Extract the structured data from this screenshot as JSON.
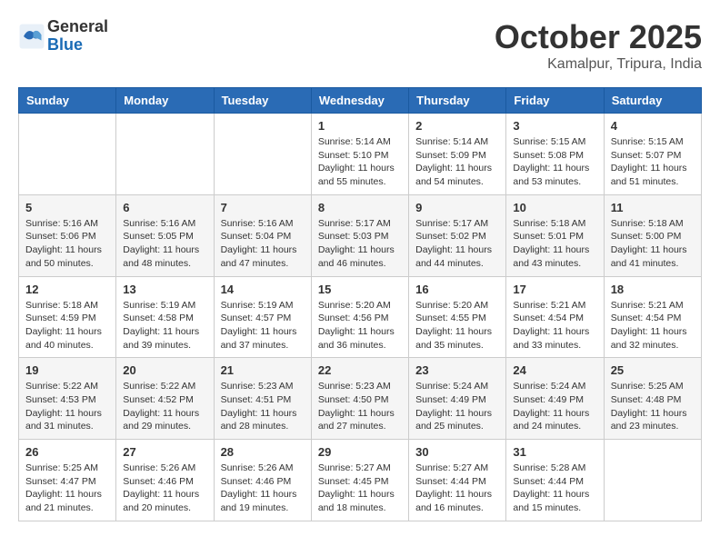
{
  "logo": {
    "general": "General",
    "blue": "Blue"
  },
  "title": {
    "month": "October 2025",
    "location": "Kamalpur, Tripura, India"
  },
  "weekdays": [
    "Sunday",
    "Monday",
    "Tuesday",
    "Wednesday",
    "Thursday",
    "Friday",
    "Saturday"
  ],
  "weeks": [
    [
      {
        "day": "",
        "info": ""
      },
      {
        "day": "",
        "info": ""
      },
      {
        "day": "",
        "info": ""
      },
      {
        "day": "1",
        "info": "Sunrise: 5:14 AM\nSunset: 5:10 PM\nDaylight: 11 hours\nand 55 minutes."
      },
      {
        "day": "2",
        "info": "Sunrise: 5:14 AM\nSunset: 5:09 PM\nDaylight: 11 hours\nand 54 minutes."
      },
      {
        "day": "3",
        "info": "Sunrise: 5:15 AM\nSunset: 5:08 PM\nDaylight: 11 hours\nand 53 minutes."
      },
      {
        "day": "4",
        "info": "Sunrise: 5:15 AM\nSunset: 5:07 PM\nDaylight: 11 hours\nand 51 minutes."
      }
    ],
    [
      {
        "day": "5",
        "info": "Sunrise: 5:16 AM\nSunset: 5:06 PM\nDaylight: 11 hours\nand 50 minutes."
      },
      {
        "day": "6",
        "info": "Sunrise: 5:16 AM\nSunset: 5:05 PM\nDaylight: 11 hours\nand 48 minutes."
      },
      {
        "day": "7",
        "info": "Sunrise: 5:16 AM\nSunset: 5:04 PM\nDaylight: 11 hours\nand 47 minutes."
      },
      {
        "day": "8",
        "info": "Sunrise: 5:17 AM\nSunset: 5:03 PM\nDaylight: 11 hours\nand 46 minutes."
      },
      {
        "day": "9",
        "info": "Sunrise: 5:17 AM\nSunset: 5:02 PM\nDaylight: 11 hours\nand 44 minutes."
      },
      {
        "day": "10",
        "info": "Sunrise: 5:18 AM\nSunset: 5:01 PM\nDaylight: 11 hours\nand 43 minutes."
      },
      {
        "day": "11",
        "info": "Sunrise: 5:18 AM\nSunset: 5:00 PM\nDaylight: 11 hours\nand 41 minutes."
      }
    ],
    [
      {
        "day": "12",
        "info": "Sunrise: 5:18 AM\nSunset: 4:59 PM\nDaylight: 11 hours\nand 40 minutes."
      },
      {
        "day": "13",
        "info": "Sunrise: 5:19 AM\nSunset: 4:58 PM\nDaylight: 11 hours\nand 39 minutes."
      },
      {
        "day": "14",
        "info": "Sunrise: 5:19 AM\nSunset: 4:57 PM\nDaylight: 11 hours\nand 37 minutes."
      },
      {
        "day": "15",
        "info": "Sunrise: 5:20 AM\nSunset: 4:56 PM\nDaylight: 11 hours\nand 36 minutes."
      },
      {
        "day": "16",
        "info": "Sunrise: 5:20 AM\nSunset: 4:55 PM\nDaylight: 11 hours\nand 35 minutes."
      },
      {
        "day": "17",
        "info": "Sunrise: 5:21 AM\nSunset: 4:54 PM\nDaylight: 11 hours\nand 33 minutes."
      },
      {
        "day": "18",
        "info": "Sunrise: 5:21 AM\nSunset: 4:54 PM\nDaylight: 11 hours\nand 32 minutes."
      }
    ],
    [
      {
        "day": "19",
        "info": "Sunrise: 5:22 AM\nSunset: 4:53 PM\nDaylight: 11 hours\nand 31 minutes."
      },
      {
        "day": "20",
        "info": "Sunrise: 5:22 AM\nSunset: 4:52 PM\nDaylight: 11 hours\nand 29 minutes."
      },
      {
        "day": "21",
        "info": "Sunrise: 5:23 AM\nSunset: 4:51 PM\nDaylight: 11 hours\nand 28 minutes."
      },
      {
        "day": "22",
        "info": "Sunrise: 5:23 AM\nSunset: 4:50 PM\nDaylight: 11 hours\nand 27 minutes."
      },
      {
        "day": "23",
        "info": "Sunrise: 5:24 AM\nSunset: 4:49 PM\nDaylight: 11 hours\nand 25 minutes."
      },
      {
        "day": "24",
        "info": "Sunrise: 5:24 AM\nSunset: 4:49 PM\nDaylight: 11 hours\nand 24 minutes."
      },
      {
        "day": "25",
        "info": "Sunrise: 5:25 AM\nSunset: 4:48 PM\nDaylight: 11 hours\nand 23 minutes."
      }
    ],
    [
      {
        "day": "26",
        "info": "Sunrise: 5:25 AM\nSunset: 4:47 PM\nDaylight: 11 hours\nand 21 minutes."
      },
      {
        "day": "27",
        "info": "Sunrise: 5:26 AM\nSunset: 4:46 PM\nDaylight: 11 hours\nand 20 minutes."
      },
      {
        "day": "28",
        "info": "Sunrise: 5:26 AM\nSunset: 4:46 PM\nDaylight: 11 hours\nand 19 minutes."
      },
      {
        "day": "29",
        "info": "Sunrise: 5:27 AM\nSunset: 4:45 PM\nDaylight: 11 hours\nand 18 minutes."
      },
      {
        "day": "30",
        "info": "Sunrise: 5:27 AM\nSunset: 4:44 PM\nDaylight: 11 hours\nand 16 minutes."
      },
      {
        "day": "31",
        "info": "Sunrise: 5:28 AM\nSunset: 4:44 PM\nDaylight: 11 hours\nand 15 minutes."
      },
      {
        "day": "",
        "info": ""
      }
    ]
  ]
}
